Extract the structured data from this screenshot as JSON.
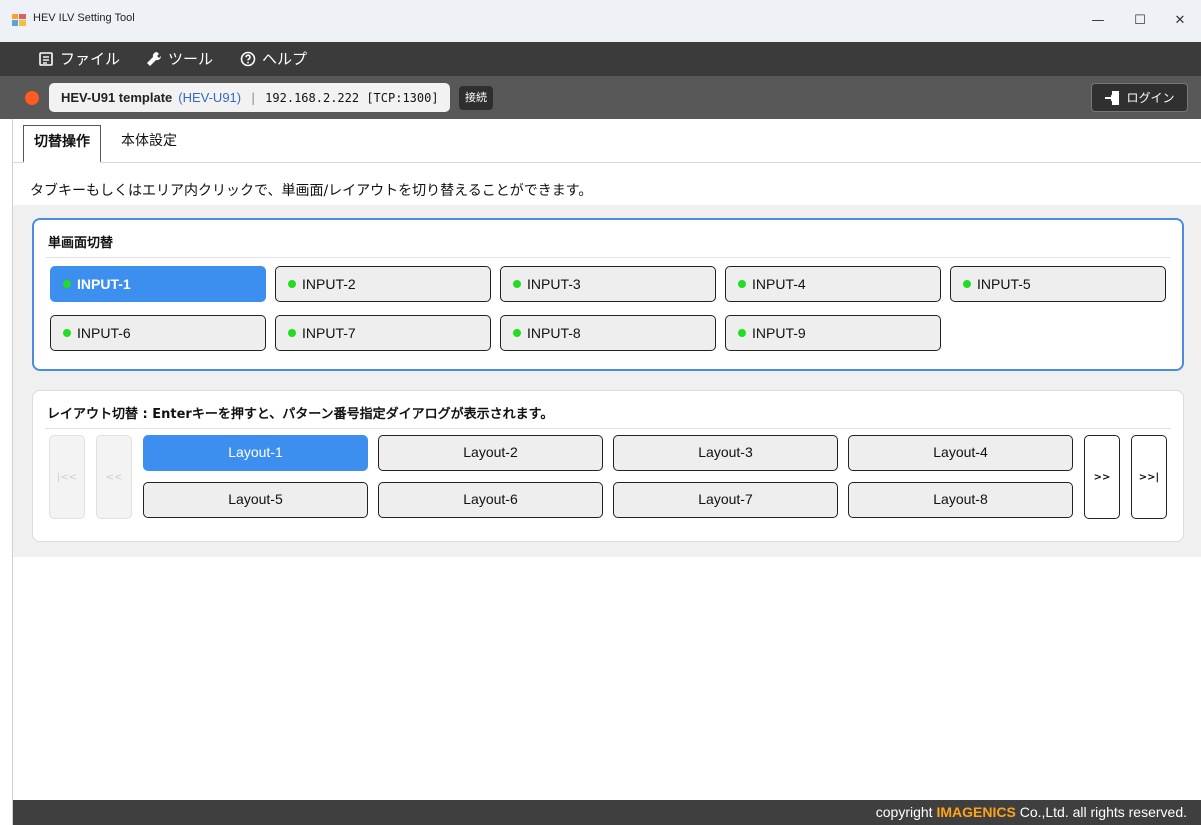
{
  "window": {
    "title": "HEV ILV Setting Tool",
    "minimize_glyph": "—",
    "maximize_glyph": "☐",
    "close_glyph": "✕"
  },
  "menu": {
    "file": "ファイル",
    "tool": "ツール",
    "help": "ヘルプ"
  },
  "connection": {
    "status_color": "#ff5a1f",
    "device_name": "HEV-U91 template",
    "model": "(HEV-U91)",
    "separator": "|",
    "address": "192.168.2.222 [TCP:1300]",
    "connect_label": "接続",
    "login_label": "ログイン"
  },
  "tabs": {
    "switching": "切替操作",
    "settings": "本体設定"
  },
  "description": "タブキーもしくはエリア内クリックで、単画面/レイアウトを切り替えることができます。",
  "single_screen": {
    "title": "単画面切替",
    "inputs": [
      "INPUT-1",
      "INPUT-2",
      "INPUT-3",
      "INPUT-4",
      "INPUT-5",
      "INPUT-6",
      "INPUT-7",
      "INPUT-8",
      "INPUT-9"
    ],
    "active_index": 0,
    "led_color": "#22dd22"
  },
  "layout_switch": {
    "title": "レイアウト切替 : Enterキーを押すと、パターン番号指定ダイアログが表示されます。",
    "layouts": [
      "Layout-1",
      "Layout-2",
      "Layout-3",
      "Layout-4",
      "Layout-5",
      "Layout-6",
      "Layout-7",
      "Layout-8"
    ],
    "active_index": 0,
    "nav_first": "|<<",
    "nav_prev": "<<",
    "nav_next": ">>",
    "nav_last": ">>|"
  },
  "footer": {
    "prefix": "copyright ",
    "brand": "IMAGENICS",
    "suffix": " Co.,Ltd. all rights reserved."
  },
  "colors": {
    "accent": "#3d8fef",
    "menubar": "#3b3b3b",
    "brand": "#ffa31a"
  }
}
